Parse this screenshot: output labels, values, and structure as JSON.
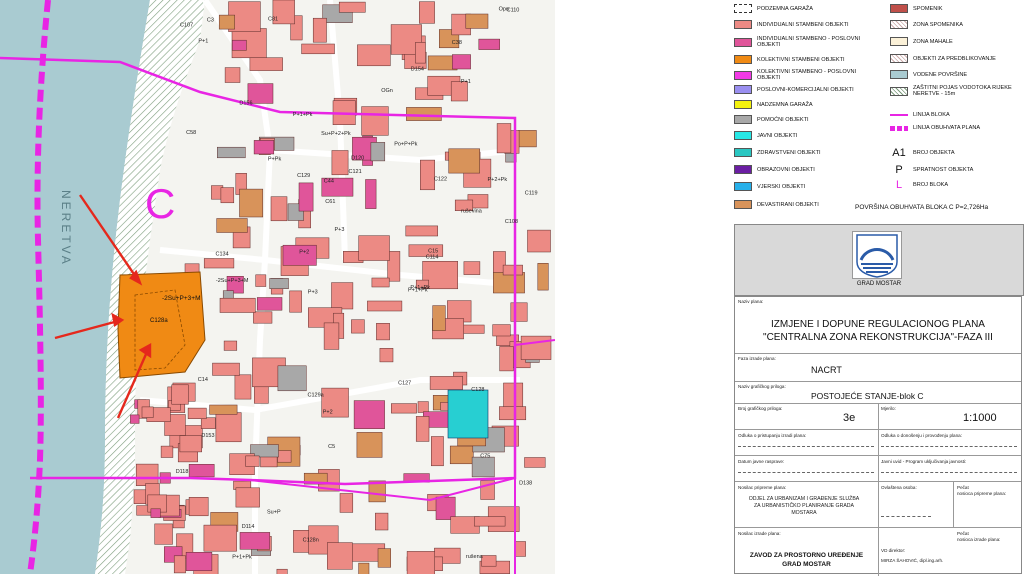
{
  "map": {
    "river_label": "NERETVA",
    "block_letter": "C",
    "labels": [
      "D153",
      "D154",
      "D138",
      "D118",
      "D156",
      "C38",
      "C58",
      "Opn",
      "OGn",
      "D120",
      "D114",
      "C114",
      "C122",
      "C129",
      "C121",
      "C14",
      "C15",
      "C81",
      "C128",
      "C127",
      "C128n",
      "C129a",
      "C61",
      "C134",
      "C107",
      "C5",
      "C75",
      "C3",
      "C119",
      "C108",
      "C110",
      "C44",
      "P+1+Pk",
      "P+2+Pk",
      "P+1",
      "P+3",
      "P+Pk",
      "Su+P",
      "P+2",
      "Su+P+2+Pk",
      "P+1+Pk",
      "-2Su+P+3+M",
      "P+1+Pk",
      "Po+P+Pk",
      "P+1",
      "P+2",
      "P+3",
      "rušena",
      "ruševina",
      "P+1+Pk"
    ],
    "highlight_label": "-2Su+P+3+M",
    "highlight_sub": "C128a",
    "colors": {
      "water": "#a9cbd1",
      "residential": "#ec8a84",
      "mixed": "#e0559a",
      "collective": "#f08a14",
      "public": "#27cfd2",
      "boundary": "#e825e4",
      "arrow": "#e5281c",
      "devastated": "#d8935a",
      "auxiliary": "#a8a8a8",
      "green_hatch": "#7f9f7f"
    }
  },
  "legend": {
    "left": [
      {
        "label": "PODZEMNA GARAŽA",
        "swatch": "#ffffff",
        "style": "dashed"
      },
      {
        "label": "INDIVIDUALNI STAMBENI OBJEKTI",
        "swatch": "#ec8a84"
      },
      {
        "label": "INDIVIDUALNI STAMBENO - POSLOVNI OBJEKTI",
        "swatch": "#e0559a"
      },
      {
        "label": "KOLEKTIVNI STAMBENI OBJEKTI",
        "swatch": "#f08a14"
      },
      {
        "label": "KOLEKTIVNI STAMBENO - POSLOVNI OBJEKTI",
        "swatch": "#f23ae6"
      },
      {
        "label": "POSLOVNI-KOMERCIJALNI OBJEKTI",
        "swatch": "#9a8ff0"
      },
      {
        "label": "NADZEMNA GARAŽA",
        "swatch": "#f4f20e"
      },
      {
        "label": "POMOĆNI OBJEKTI",
        "swatch": "#a8a8a8"
      },
      {
        "label": "JAVNI OBJEKTI",
        "swatch": "#27e8e6"
      },
      {
        "label": "ZDRAVSTVENI OBJEKTI",
        "swatch": "#2bc7c2"
      },
      {
        "label": "OBRAZOVNI OBJEKTI",
        "swatch": "#6b1ea3"
      },
      {
        "label": "VJERSKI OBJEKTI",
        "swatch": "#27b0ea"
      },
      {
        "label": "DEVASTIRANI OBJEKTI",
        "swatch": "#d8935a"
      }
    ],
    "right": [
      {
        "label": "SPOMENIK",
        "swatch": "#c0504a",
        "style": "solid"
      },
      {
        "label": "ZONA SPOMENIKA",
        "swatch": "#f3d7cf",
        "style": "hatch"
      },
      {
        "label": "ZONA MAHALE",
        "swatch": "#fbf1d8",
        "style": "solid"
      },
      {
        "label": "OBJEKTI ZA PREDBLIKOVANJE",
        "swatch": "#f3d4b8",
        "style": "hatch"
      },
      {
        "label": "VODENE POVRŠINE",
        "swatch": "#a9cbd1",
        "style": "solid"
      },
      {
        "label": "ZAŠTITNI POJAS VODOTOKA RIJEKE NERETVE - 15m",
        "swatch": "#ffffff",
        "style": "hatchg"
      },
      {
        "label": "LINIJA BLOKA",
        "swatch": "#e825e4",
        "style": "line"
      },
      {
        "label": "LINIJA OBUHVATA PLANA",
        "swatch": "#e825e4",
        "style": "thickline"
      },
      {
        "label": "BROJ OBJEKTA",
        "symbol": "A1"
      },
      {
        "label": "SPRATNOST OBJEKTA",
        "symbol": "P"
      },
      {
        "label": "BROJ BLOKA",
        "symbol": "L"
      }
    ],
    "area": "POVRŠINA OBUHVATA BLOKA C  P=2,726Ha"
  },
  "logo": {
    "caption": "GRAD MOSTAR"
  },
  "titleblock": {
    "naziv_plana_caption": "Naziv plana:",
    "naziv_plana_1": "IZMJENE I DOPUNE REGULACIONOG PLANA",
    "naziv_plana_2": "\"CENTRALNA ZONA REKONSTRUKCIJA\"-FAZA III",
    "faza_caption": "Faza izrade plana:",
    "faza": "NACRT",
    "prilog_caption": "Naziv grafičkog priloga:",
    "prilog": "POSTOJEĆE STANJE-blok C",
    "broj_caption": "Broj grafičkog priloga:",
    "broj": "3e",
    "mjerilo_caption": "Mjerilo:",
    "mjerilo": "1:1000",
    "odluka_pristup": "Odluka o pristupanju izradi plana:",
    "odluka_donos": "Odluka o donošenju i provođenju plana:",
    "datum_rasprave": "Datum javne rasprave:",
    "javni_uvid": "Javni uvid - Program uključivanja javnosti:",
    "nosilac_pripreme_caption": "Nosilac pripreme plana:",
    "nosilac_pripreme": "ODJEL ZA URBANIZAM I GRAĐENJE SLUŽBA ZA URBANISTIČKO PLANIRANJE GRADA MOSTARA",
    "ovlastena_osoba": "Ovlaštena osoba:",
    "pecat_1": "Pečat",
    "pecat_1b": "nosioca pripreme plana:",
    "nosilac_izrade_caption": "Nosilac izrade plana:",
    "nosilac_izrade_1": "ZAVOD ZA PROSTORNO UREĐENJE",
    "nosilac_izrade_2": "GRAD MOSTAR",
    "vd_direktor": "VD direktor:",
    "direktor_ime": "MIRZA ŠAHOVIĆ, dipl.ing.arh.",
    "pecat_2": "Pečat",
    "pecat_2b": "nosioca izrade plana:"
  }
}
